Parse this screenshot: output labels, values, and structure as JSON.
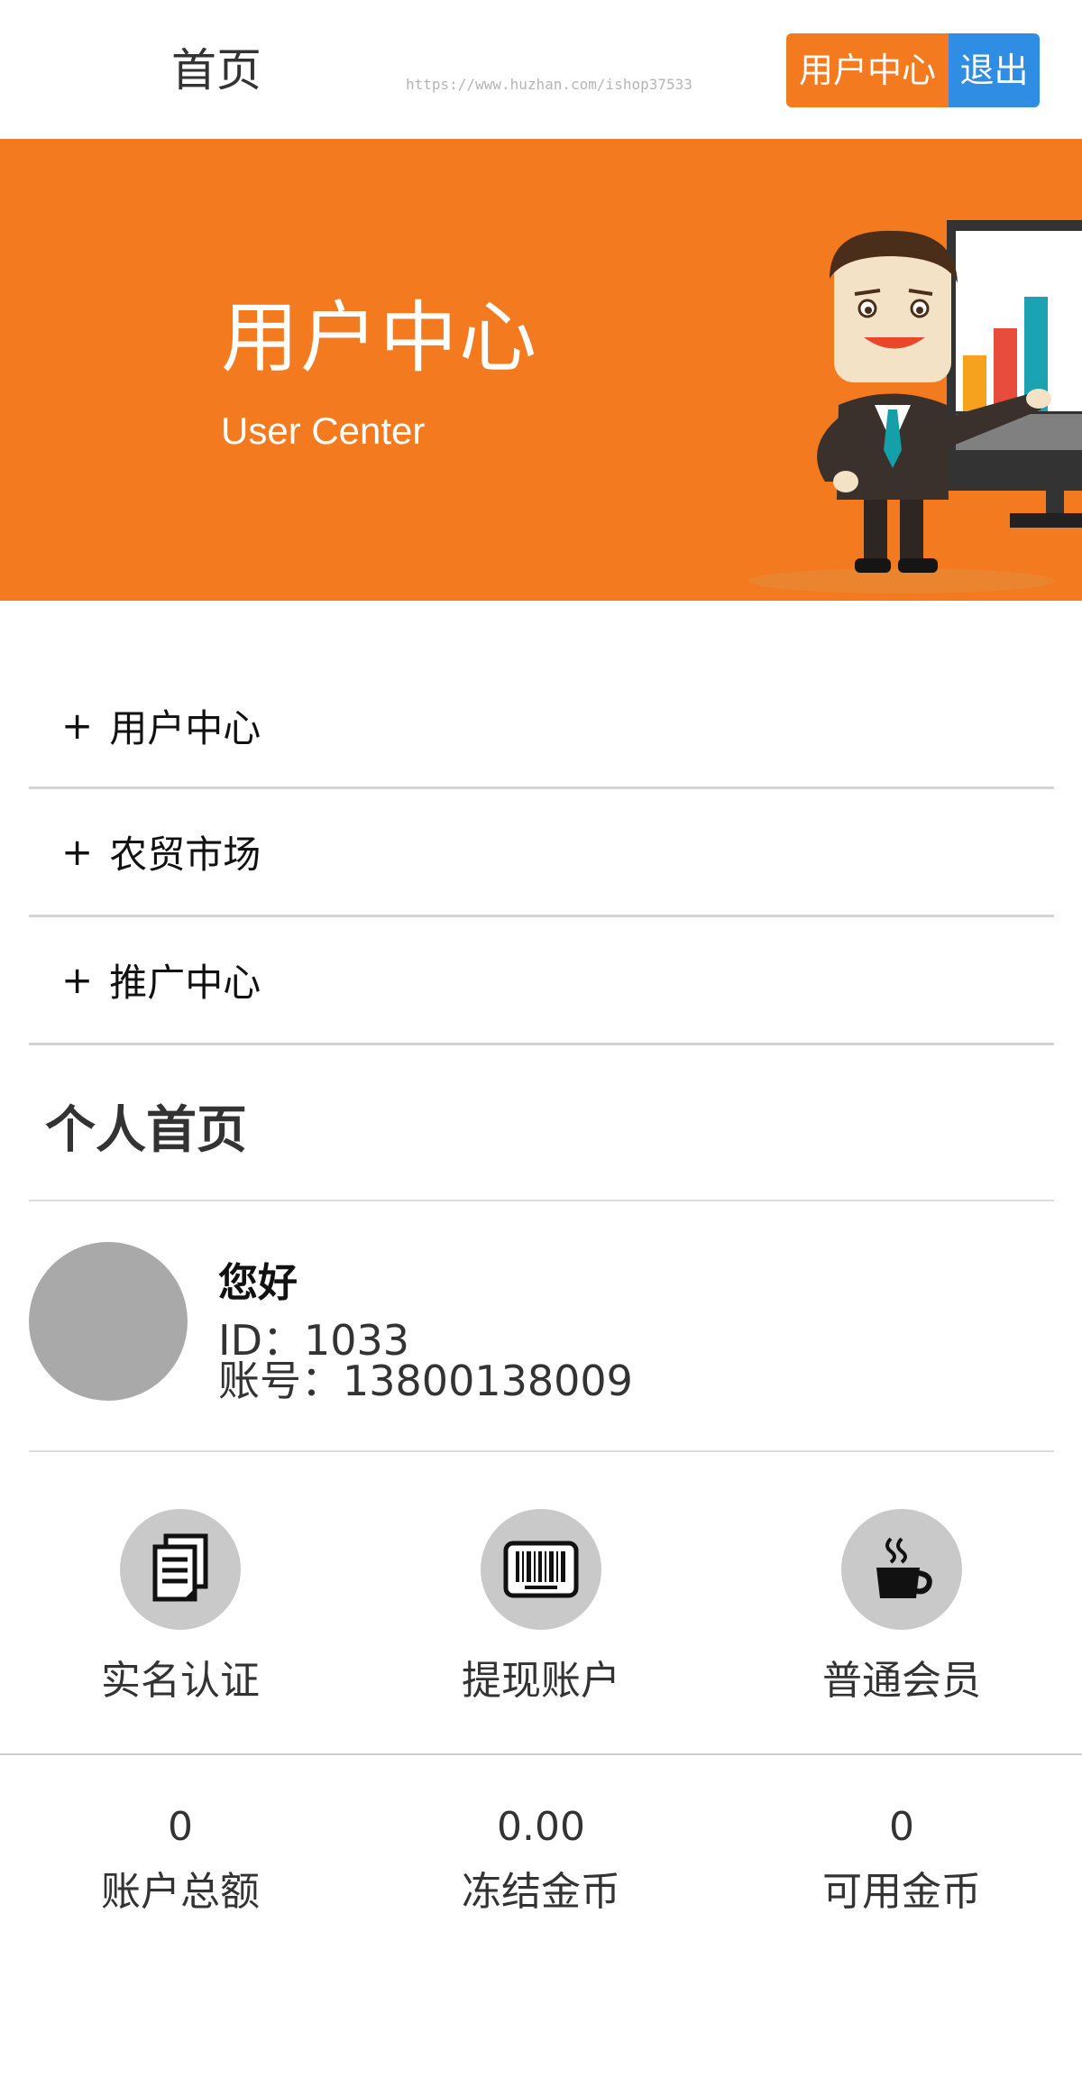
{
  "header": {
    "title": "首页",
    "watermark": "https://www.huzhan.com/ishop37533",
    "user_center_label": "用户中心",
    "logout_label": "退出"
  },
  "banner": {
    "title": "用户中心",
    "subtitle": "User Center"
  },
  "menu": {
    "items": [
      {
        "plus": "+",
        "label": "用户中心"
      },
      {
        "plus": "+",
        "label": "农贸市场"
      },
      {
        "plus": "+",
        "label": "推广中心"
      }
    ]
  },
  "section": {
    "title": "个人首页"
  },
  "profile": {
    "greeting": "您好",
    "id_line": "ID：1033",
    "account_line": "账号：13800138009"
  },
  "actions": [
    {
      "label": "实名认证",
      "icon": "document-icon"
    },
    {
      "label": "提现账户",
      "icon": "barcode-icon"
    },
    {
      "label": "普通会员",
      "icon": "coffee-cup-icon"
    }
  ],
  "stats": [
    {
      "value": "0",
      "label": "账户总额"
    },
    {
      "value": "0.00",
      "label": "冻结金币"
    },
    {
      "value": "0",
      "label": "可用金币"
    }
  ],
  "colors": {
    "accent_orange": "#f47a20",
    "logout_blue": "#2f8de4",
    "avatar_gray": "#a9a9a9",
    "icon_circle_gray": "#c9c9c9"
  }
}
